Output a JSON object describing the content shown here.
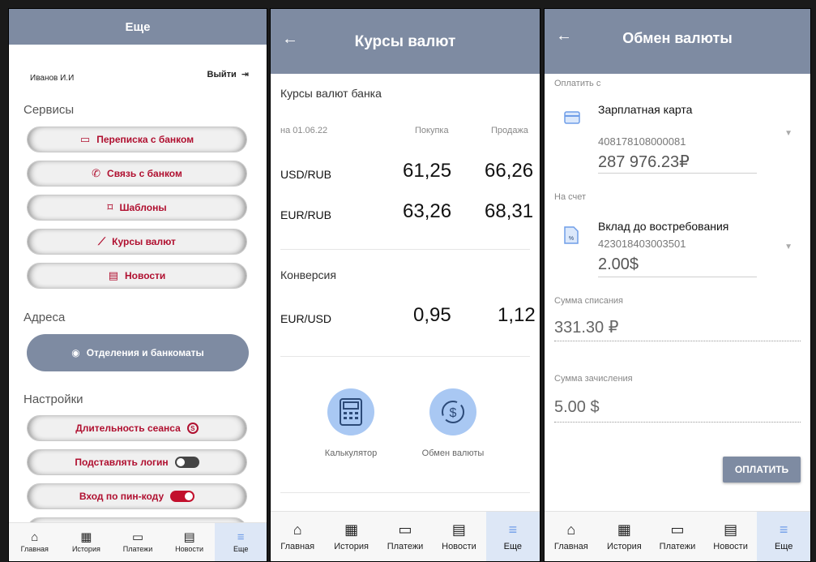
{
  "nav": [
    "Главная",
    "История",
    "Платежи",
    "Новости",
    "Еще"
  ],
  "panel1": {
    "title": "Еще",
    "user": "Иванов И.И",
    "logout": "Выйти",
    "services_title": "Сервисы",
    "services": [
      "Переписка с банком",
      "Связь с банком",
      "Шаблоны",
      "Курсы валют",
      "Новости"
    ],
    "addresses_title": "Адреса",
    "branches": "Отделения и банкоматы",
    "settings_title": "Настройки",
    "settings": [
      "Длительность сеанса",
      "Подставлять логин",
      "Вход по пин-коду"
    ],
    "settings_state": {
      "login_toggle": "off",
      "pin_toggle": "on"
    }
  },
  "panel2": {
    "title": "Курсы валют",
    "bank_rates": "Курсы валют банка",
    "date": "на 01.06.22",
    "buy": "Покупка",
    "sell": "Продажа",
    "rates": [
      {
        "pair": "USD/RUB",
        "buy": "61,25",
        "sell": "66,26"
      },
      {
        "pair": "EUR/RUB",
        "buy": "63,26",
        "sell": "68,31"
      }
    ],
    "conversion": "Конверсия",
    "conv": {
      "pair": "EUR/USD",
      "buy": "0,95",
      "sell": "1,12"
    },
    "calc": "Калькулятор",
    "exchange": "Обмен валюты"
  },
  "panel3": {
    "title": "Обмен валюты",
    "pay_from": "Оплатить с",
    "from_name": "Зарплатная карта",
    "from_acc": "408178108000081",
    "from_amt": "287 976.23₽",
    "to_label": "На счет",
    "to_name": "Вклад до востребования",
    "to_acc": "423018403003501",
    "to_amt": "2.00$",
    "debit_label": "Сумма списания",
    "debit": "331.30 ₽",
    "credit_label": "Сумма зачисления",
    "credit": "5.00 $",
    "pay": "ОПЛАТИТЬ"
  },
  "colors": {
    "header": "#7e8ba2",
    "accent_red": "#b01030",
    "accent_blue": "#a9c8f3",
    "active_tab": "#dde7f6"
  }
}
